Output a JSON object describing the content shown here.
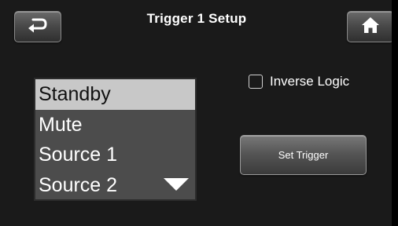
{
  "header": {
    "title": "Trigger 1 Setup",
    "back_icon": "back-arrow-icon",
    "home_icon": "home-icon"
  },
  "source_list": {
    "items": [
      {
        "label": "Standby",
        "selected": true
      },
      {
        "label": "Mute",
        "selected": false
      },
      {
        "label": "Source 1",
        "selected": false
      },
      {
        "label": "Source 2",
        "selected": false
      }
    ],
    "scroll_icon": "triangle-down-icon"
  },
  "options": {
    "inverse_logic_label": "Inverse Logic",
    "inverse_logic_checked": false
  },
  "actions": {
    "set_trigger_label": "Set Trigger"
  },
  "colors": {
    "background": "#1a1a1a",
    "list_background": "#4c4c4c",
    "selected_row": "#c8c8c8",
    "button_gradient_top": "#6a6a6a",
    "button_gradient_bottom": "#2f2f2f",
    "text": "#ffffff"
  }
}
